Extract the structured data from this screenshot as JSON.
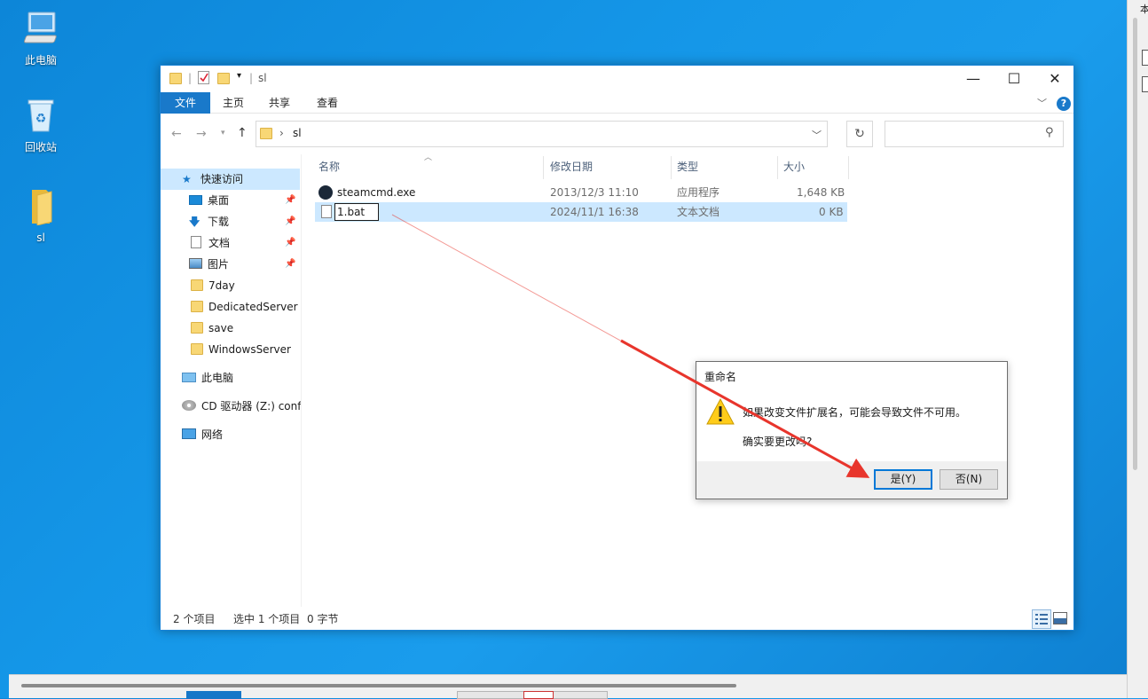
{
  "desktop": {
    "icons": [
      {
        "label": "此电脑"
      },
      {
        "label": "回收站"
      },
      {
        "label": "sl"
      }
    ]
  },
  "right_strip": {
    "text": "本"
  },
  "explorer": {
    "title": "sl",
    "ribbon_tabs": [
      "文件",
      "主页",
      "共享",
      "查看"
    ],
    "address": {
      "folder": "sl"
    },
    "nav": {
      "quick_access": "快速访问",
      "items": [
        {
          "label": "桌面",
          "pinned": true
        },
        {
          "label": "下载",
          "pinned": true
        },
        {
          "label": "文档",
          "pinned": true
        },
        {
          "label": "图片",
          "pinned": true
        },
        {
          "label": "7day"
        },
        {
          "label": "DedicatedServer"
        },
        {
          "label": "save"
        },
        {
          "label": "WindowsServer"
        }
      ],
      "this_pc": "此电脑",
      "cd_drive": "CD 驱动器 (Z:) confi",
      "network": "网络"
    },
    "columns": [
      "名称",
      "修改日期",
      "类型",
      "大小"
    ],
    "files": [
      {
        "name": "steamcmd.exe",
        "date": "2013/12/3 11:10",
        "type": "应用程序",
        "size": "1,648 KB",
        "selected": false
      },
      {
        "name": "1.bat",
        "date": "2024/11/1 16:38",
        "type": "文本文档",
        "size": "0 KB",
        "selected": true
      }
    ],
    "status": {
      "count": "2 个项目",
      "selected": "选中 1 个项目",
      "bytes": "0 字节"
    }
  },
  "dialog": {
    "title": "重命名",
    "message": "如果改变文件扩展名，可能会导致文件不可用。",
    "question": "确实要更改吗?",
    "yes": "是(Y)",
    "no": "否(N)"
  },
  "colors": {
    "accent": "#1979ca",
    "selection": "#cce8ff",
    "annotation_arrow": "#e8352c"
  }
}
